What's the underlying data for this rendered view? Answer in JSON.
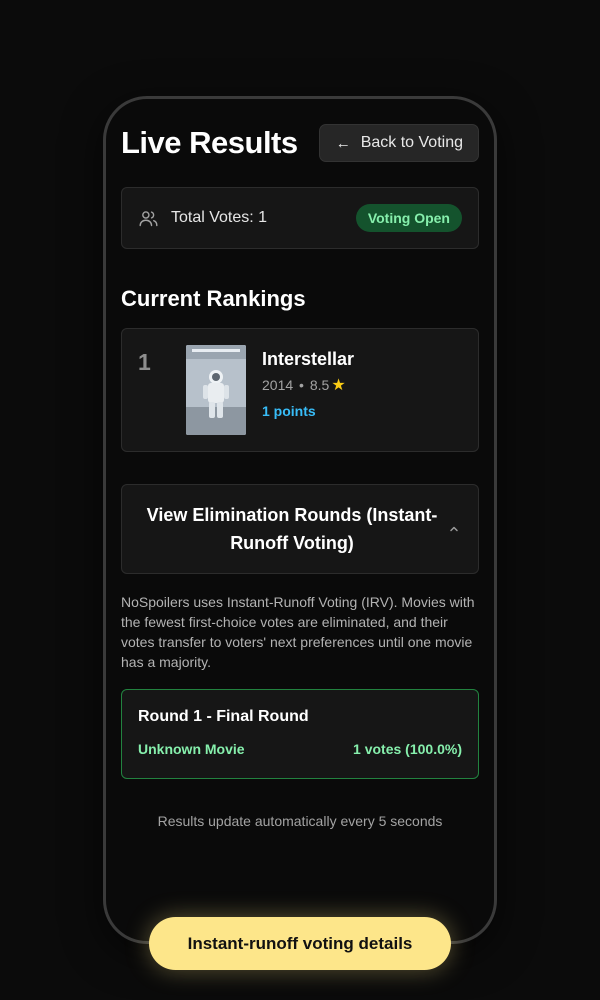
{
  "header": {
    "title": "Live Results",
    "back_label": "Back to Voting"
  },
  "summary": {
    "total_votes_label": "Total Votes: 1",
    "status": "Voting Open",
    "icon": "users-icon"
  },
  "rankings": {
    "title": "Current Rankings",
    "items": [
      {
        "rank": "1",
        "title": "Interstellar",
        "year": "2014",
        "rating": "8.5",
        "points": "1 points",
        "poster_icon": "movie-poster"
      }
    ]
  },
  "irv": {
    "toggle_label": "View Elimination Rounds (Instant-Runoff Voting)",
    "description": "NoSpoilers uses Instant-Runoff Voting (IRV). Movies with the fewest first-choice votes are eliminated, and their votes transfer to voters' next preferences until one movie has a majority.",
    "rounds": [
      {
        "title": "Round 1 - Final Round",
        "movie": "Unknown Movie",
        "votes": "1 votes (100.0%)"
      }
    ]
  },
  "footer": {
    "note": "Results update automatically every 5 seconds"
  },
  "cta": {
    "label": "Instant-runoff voting details"
  },
  "colors": {
    "accent_green": "#86efac",
    "accent_blue": "#38bdf8",
    "cta_yellow": "#fde68a",
    "star": "#facc15"
  }
}
